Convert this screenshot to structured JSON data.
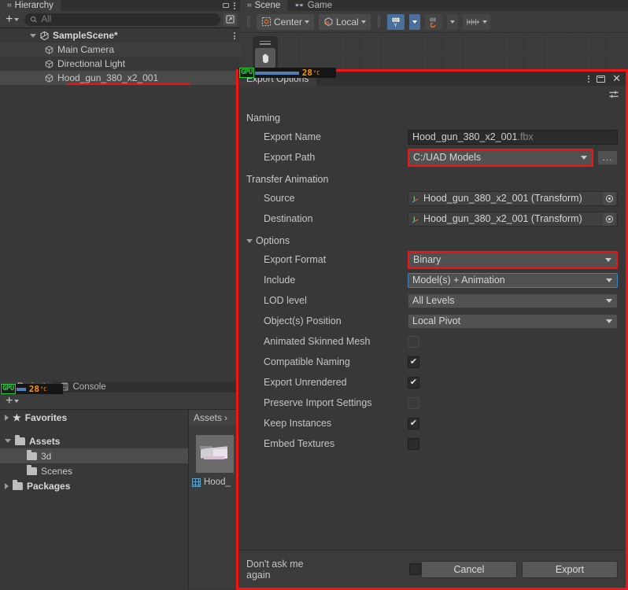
{
  "hierarchy": {
    "tab": {
      "label": "Hierarchy",
      "icon": "hierarchy-icon"
    },
    "toolbar": {
      "add_label": "+",
      "search_placeholder": "All",
      "search_value": ""
    },
    "rows": [
      {
        "label": "SampleScene*",
        "icon": "unity-scene-icon",
        "depth": 1,
        "expanded": true,
        "selected": false
      },
      {
        "label": "Main Camera",
        "icon": "gameobject-cube-icon",
        "depth": 2,
        "expanded": false,
        "selected": false
      },
      {
        "label": "Directional Light",
        "icon": "gameobject-cube-icon",
        "depth": 2,
        "expanded": false,
        "selected": false
      },
      {
        "label": "Hood_gun_380_x2_001",
        "icon": "gameobject-cube-icon",
        "depth": 2,
        "expanded": false,
        "selected": true
      }
    ]
  },
  "scene": {
    "tabs": [
      {
        "label": "Scene",
        "icon": "scene-icon",
        "active": true
      },
      {
        "label": "Game",
        "icon": "game-icon",
        "active": false
      }
    ],
    "toolbar": {
      "pivot_mode": "Center",
      "handle_space": "Local",
      "grid_snap_icon": "grid-snap-icon",
      "magnet_snap_icon": "magnet-snap-icon",
      "increment_snap_icon": "increment-snap-icon"
    },
    "tool_overlay": {
      "active_tool": "hand-tool"
    }
  },
  "project": {
    "tabs": [
      {
        "label": "Project",
        "icon": "project-icon",
        "active": true
      },
      {
        "label": "Console",
        "icon": "console-icon",
        "active": false
      }
    ],
    "toolbar": {
      "add_label": "+"
    },
    "tree": [
      {
        "label": "Favorites",
        "icon": "star-icon",
        "depth": 0,
        "arrow": "right",
        "bold": true,
        "selected": false
      },
      {
        "label": "Assets",
        "icon": "folder-open-icon",
        "depth": 0,
        "arrow": "down",
        "bold": true,
        "selected": false
      },
      {
        "label": "3d",
        "icon": "folder-icon",
        "depth": 1,
        "arrow": "none",
        "bold": false,
        "selected": true
      },
      {
        "label": "Scenes",
        "icon": "folder-icon",
        "depth": 1,
        "arrow": "none",
        "bold": false,
        "selected": false
      },
      {
        "label": "Packages",
        "icon": "folder-icon",
        "depth": 0,
        "arrow": "right",
        "bold": true,
        "selected": false
      }
    ],
    "breadcrumb": "Assets",
    "asset": {
      "label": "Hood_",
      "icon": "mesh-icon"
    }
  },
  "gpu_overlays": [
    {
      "tag": "GPU",
      "temp": "28",
      "unit": "°C"
    },
    {
      "tag": "GPU",
      "temp": "28",
      "unit": "°C"
    }
  ],
  "dialog": {
    "title": "Export Options",
    "window_controls": {
      "menu": "kebab-menu-icon",
      "maximize": "maximize-icon",
      "close": "close-icon"
    },
    "settings_icon": "settings-sliders-icon",
    "sections": {
      "naming": {
        "title": "Naming",
        "export_name": {
          "label": "Export Name",
          "value": "Hood_gun_380_x2_001",
          "extension": ".fbx"
        },
        "export_path": {
          "label": "Export Path",
          "value": "C:/UAD Models",
          "browse_label": "...",
          "highlighted": true
        }
      },
      "transfer_animation": {
        "title": "Transfer Animation",
        "source": {
          "label": "Source",
          "value": "Hood_gun_380_x2_001 (Transform)"
        },
        "destination": {
          "label": "Destination",
          "value": "Hood_gun_380_x2_001 (Transform)"
        }
      },
      "options": {
        "title": "Options",
        "expanded": true,
        "dropdowns": [
          {
            "label": "Export Format",
            "value": "Binary",
            "highlighted": true,
            "focused": false
          },
          {
            "label": "Include",
            "value": "Model(s) + Animation",
            "highlighted": false,
            "focused": true
          },
          {
            "label": "LOD level",
            "value": "All Levels",
            "highlighted": false,
            "focused": false
          },
          {
            "label": "Object(s) Position",
            "value": "Local Pivot",
            "highlighted": false,
            "focused": false
          }
        ],
        "checkboxes": [
          {
            "label": "Animated Skinned Mesh",
            "checked": false
          },
          {
            "label": "Compatible Naming",
            "checked": true
          },
          {
            "label": "Export Unrendered",
            "checked": true
          },
          {
            "label": "Preserve Import Settings",
            "checked": false
          },
          {
            "label": "Keep Instances",
            "checked": true
          },
          {
            "label": "Embed Textures",
            "checked": false
          }
        ]
      }
    },
    "footer": {
      "dont_ask_label": "Don't ask me again",
      "dont_ask_checked": false,
      "cancel_label": "Cancel",
      "export_label": "Export"
    }
  },
  "colors": {
    "accent_highlight": "#f01414",
    "panel_bg": "#383838",
    "focus_blue": "#3f7fbf",
    "toolbar_active": "#4b6f9b",
    "gpu_green": "#2ecc40",
    "gpu_orange": "#ff9500"
  }
}
